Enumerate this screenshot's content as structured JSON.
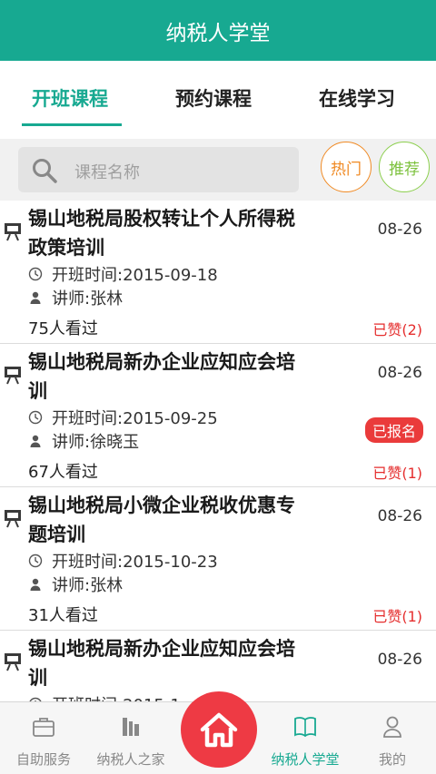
{
  "header": {
    "title": "纳税人学堂"
  },
  "tabs": [
    {
      "label": "开班课程",
      "active": true
    },
    {
      "label": "预约课程",
      "active": false
    },
    {
      "label": "在线学习",
      "active": false
    }
  ],
  "search": {
    "placeholder": "课程名称",
    "hot_label": "热门",
    "recommend_label": "推荐"
  },
  "courses": [
    {
      "title": "锡山地税局股权转让个人所得税政策培训",
      "date": "08-26",
      "time": "开班时间:2015-09-18",
      "teacher": "讲师:张林",
      "views": "75人看过",
      "likes": "已赞(2)",
      "badge": ""
    },
    {
      "title": "锡山地税局新办企业应知应会培训",
      "date": "08-26",
      "time": "开班时间:2015-09-25",
      "teacher": "讲师:徐晓玉",
      "views": "67人看过",
      "likes": "已赞(1)",
      "badge": "已报名"
    },
    {
      "title": "锡山地税局小微企业税收优惠专题培训",
      "date": "08-26",
      "time": "开班时间:2015-10-23",
      "teacher": "讲师:张林",
      "views": "31人看过",
      "likes": "已赞(1)",
      "badge": ""
    },
    {
      "title": "锡山地税局新办企业应知应会培训",
      "date": "08-26",
      "time": "开班时间:2015-1",
      "teacher": "",
      "views": "",
      "likes": "",
      "badge": ""
    }
  ],
  "nav": [
    {
      "label": "自助服务",
      "icon": "briefcase-icon",
      "active": false
    },
    {
      "label": "纳税人之家",
      "icon": "building-icon",
      "active": false
    },
    {
      "label": "",
      "icon": "home-icon",
      "active": false
    },
    {
      "label": "纳税人学堂",
      "icon": "book-icon",
      "active": true
    },
    {
      "label": "我的",
      "icon": "person-icon",
      "active": false
    }
  ],
  "colors": {
    "primary": "#17a991",
    "danger": "#ea3b3b",
    "hot": "#f08a24",
    "recommend": "#8ccf4e"
  }
}
